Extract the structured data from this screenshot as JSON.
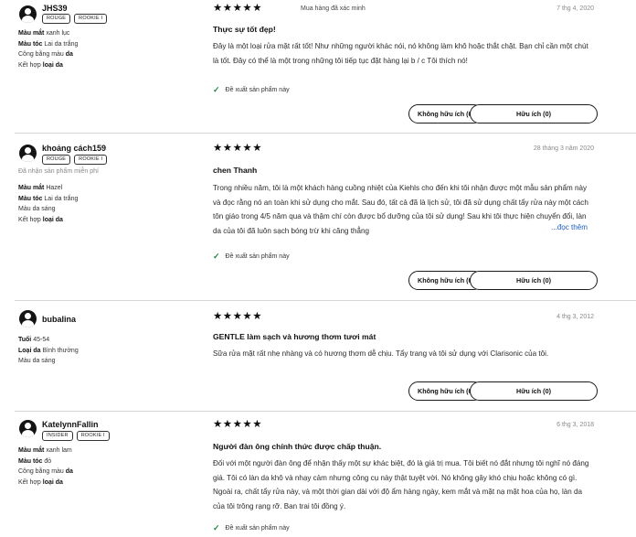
{
  "reviews": [
    {
      "username": "JHS39",
      "badges": [
        "ROUGE",
        "ROOKIE I"
      ],
      "freebie": "",
      "attributes": [
        {
          "label": "Màu mắt",
          "value": "xanh lục"
        },
        {
          "label": "Màu tóc",
          "value": "Lai da trắng"
        },
        {
          "label": "Công bằng màu",
          "value": "da"
        },
        {
          "label": "Kết hợp",
          "value": "loại da"
        }
      ],
      "stars": "★★★★★",
      "verified": "Mua hàng đã xác minh",
      "date": "7 thg 4, 2020",
      "title": "Thực sự tốt đẹp!",
      "body": "Đây là một loại rửa mặt rất tốt! Như những người khác nói, nó không làm khô hoặc thắt chặt. Bạn chỉ cần một chút là tốt. Đây có thể là một trong những tôi tiếp tục đặt hàng lại b / c Tôi thích nó!",
      "read_more": "",
      "recommend": "Đề xuất sản phẩm này",
      "not_helpful": "Không hữu ích (0)",
      "helpful": "Hữu ích (0)"
    },
    {
      "username": "khoảng cách159",
      "badges": [
        "ROUGE",
        "ROOKIE I"
      ],
      "freebie": "Đã nhận sản phẩm miễn phí",
      "attributes": [
        {
          "label": "Màu mắt",
          "value": "Hazel"
        },
        {
          "label": "Màu tóc",
          "value": "Lai da trắng"
        },
        {
          "label": "Màu",
          "value": "da sáng"
        },
        {
          "label": "Kết hợp",
          "value": "loại da"
        }
      ],
      "stars": "★★★★★",
      "verified": "",
      "date": "28 tháng 3 năm 2020",
      "title": "chen Thanh",
      "body": "Trong nhiều năm, tôi là một khách hàng cuồng nhiệt của Kiehls cho đến khi tôi nhận được một mẫu sản phẩm này và đọc rằng nó an toàn khi sử dụng cho mắt. Sau đó, tất cả đã là lịch sử, tôi đã sử dụng chất tẩy rửa này một cách tôn giáo trong 4/5 năm qua và thậm chí còn được bổ dưỡng của tôi sử dụng! Sau khi tôi thực hiện chuyển đổi, làn da của tôi đã luôn sạch bóng trừ khi căng thẳng",
      "read_more": "...đọc thêm",
      "recommend": "Đề xuất sản phẩm này",
      "not_helpful": "Không hữu ích (0)",
      "helpful": "Hữu ích (0)"
    },
    {
      "username": "bubalina",
      "badges": [],
      "freebie": "",
      "attributes": [
        {
          "label": "Tuổi",
          "value": "45-54"
        },
        {
          "label": "Loại da",
          "value": "Bình thường"
        },
        {
          "label": "Màu",
          "value": "da sáng"
        }
      ],
      "stars": "★★★★★",
      "verified": "",
      "date": "4 thg 3, 2012",
      "title": "GENTLE làm sạch và hương thơm tươi mát",
      "body": "Sữa rửa mặt rất nhẹ nhàng và có hương thơm dễ chịu. Tẩy trang và tôi sử dụng với Clarisonic của tôi.",
      "read_more": "",
      "recommend": "",
      "not_helpful": "Không hữu ích (0)",
      "helpful": "Hữu ích (0)"
    },
    {
      "username": "KatelynnFallin",
      "badges": [
        "INSIDER",
        "ROOKIE I"
      ],
      "freebie": "",
      "attributes": [
        {
          "label": "Màu mắt",
          "value": "xanh lam"
        },
        {
          "label": "Màu tóc",
          "value": "đỏ"
        },
        {
          "label": "Công bằng màu",
          "value": "da"
        },
        {
          "label": "Kết hợp",
          "value": "loại da"
        }
      ],
      "stars": "★★★★★",
      "verified": "",
      "date": "6 thg 3, 2018",
      "title": "Người đàn ông chính thức được chấp thuận.",
      "body": "Đối với một người đàn ông để nhận thấy một sự khác biệt, đó là giá trị mua. Tôi biết nó đắt nhưng tôi nghĩ nó đáng giá. Tôi có làn da khô và nhạy cảm nhưng công cụ này thật tuyệt vời. Nó không gây khó chịu hoặc không có gì. Ngoài ra, chất tẩy rửa này, và một thời gian dài với độ ẩm hàng ngày, kem mắt và mặt nạ mặt hoa của họ, làn da của tôi trông rạng rỡ. Ban trai tôi đồng ý.",
      "read_more": "",
      "recommend": "Đề xuất sản phẩm này",
      "not_helpful": "",
      "helpful": ""
    }
  ]
}
